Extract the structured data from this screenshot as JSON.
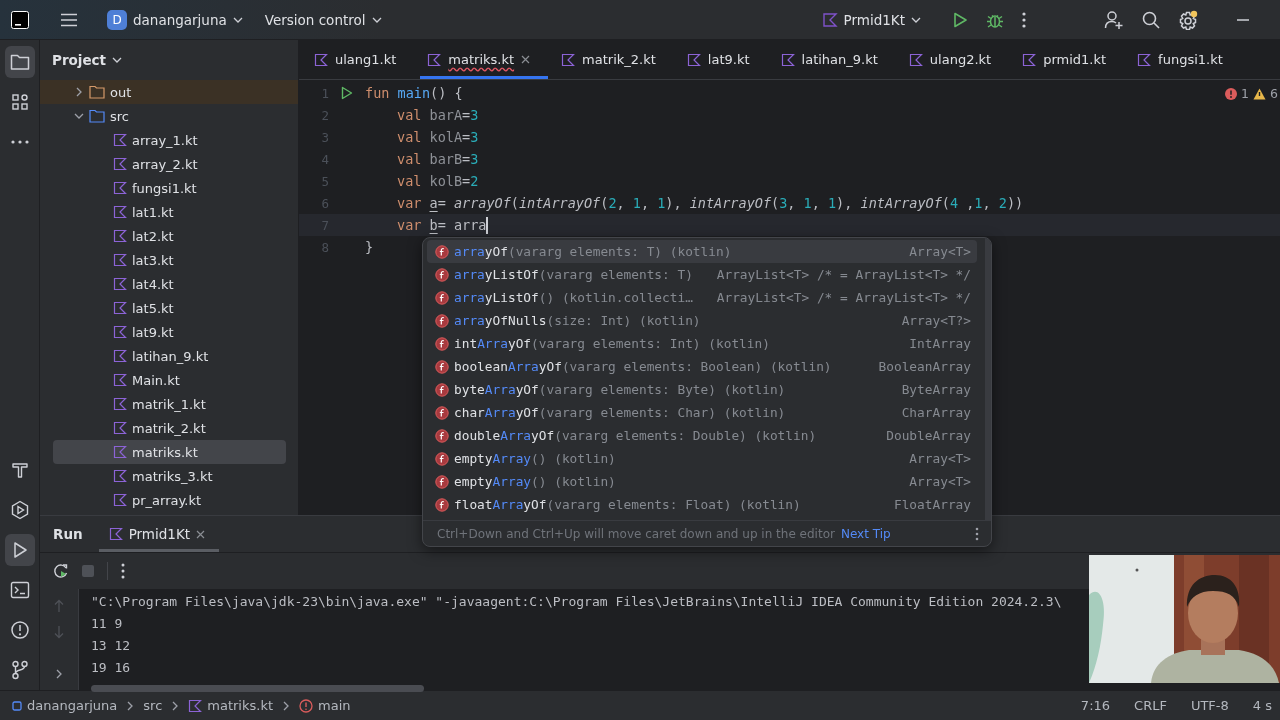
{
  "top_bar": {
    "project_initial": "D",
    "project_name": "danangarjuna",
    "vcs": "Version control",
    "run_config": "Prmid1Kt"
  },
  "tool_strip": {
    "top": [
      {
        "kind": "project",
        "selected": true
      },
      {
        "kind": "structure",
        "selected": false
      },
      {
        "kind": "more",
        "selected": false
      }
    ],
    "bottom": [
      {
        "kind": "build",
        "selected": false
      },
      {
        "kind": "services",
        "selected": false
      },
      {
        "kind": "run",
        "selected": true
      },
      {
        "kind": "terminal",
        "selected": false
      },
      {
        "kind": "problems",
        "selected": false
      },
      {
        "kind": "git",
        "selected": false
      }
    ]
  },
  "project_panel": {
    "title": "Project",
    "tree": [
      {
        "label": "out",
        "kind": "folder",
        "expanded": false,
        "excluded": true,
        "selected": false
      },
      {
        "label": "src",
        "kind": "folder",
        "expanded": true,
        "excluded": false,
        "selected": false,
        "children": [
          {
            "label": "array_1.kt",
            "selected": false
          },
          {
            "label": "array_2.kt",
            "selected": false
          },
          {
            "label": "fungsi1.kt",
            "selected": false
          },
          {
            "label": "lat1.kt",
            "selected": false
          },
          {
            "label": "lat2.kt",
            "selected": false
          },
          {
            "label": "lat3.kt",
            "selected": false
          },
          {
            "label": "lat4.kt",
            "selected": false
          },
          {
            "label": "lat5.kt",
            "selected": false
          },
          {
            "label": "lat9.kt",
            "selected": false
          },
          {
            "label": "latihan_9.kt",
            "selected": false
          },
          {
            "label": "Main.kt",
            "selected": false
          },
          {
            "label": "matrik_1.kt",
            "selected": false
          },
          {
            "label": "matrik_2.kt",
            "selected": false
          },
          {
            "label": "matriks.kt",
            "selected": true
          },
          {
            "label": "matriks_3.kt",
            "selected": false
          },
          {
            "label": "pr_array.kt",
            "selected": false
          }
        ]
      }
    ]
  },
  "editor_tabs": [
    {
      "label": "ulang1.kt",
      "selected": false,
      "error": false
    },
    {
      "label": "matriks.kt",
      "selected": true,
      "error": true
    },
    {
      "label": "matrik_2.kt",
      "selected": false,
      "error": false
    },
    {
      "label": "lat9.kt",
      "selected": false,
      "error": false
    },
    {
      "label": "latihan_9.kt",
      "selected": false,
      "error": false
    },
    {
      "label": "ulang2.kt",
      "selected": false,
      "error": false
    },
    {
      "label": "prmid1.kt",
      "selected": false,
      "error": false
    },
    {
      "label": "fungsi1.kt",
      "selected": false,
      "error": false
    }
  ],
  "inspections": {
    "errors": "1",
    "warnings": "6"
  },
  "code": [
    {
      "number": "1",
      "run": true,
      "current": false,
      "indented": false,
      "tokens": [
        {
          "kind": "kw",
          "text": "fun "
        },
        {
          "kind": "decl",
          "text": "main"
        },
        {
          "kind": "plain",
          "text": "() {"
        }
      ]
    },
    {
      "number": "2",
      "run": false,
      "current": false,
      "indented": true,
      "tokens": [
        {
          "kind": "kw",
          "text": "val "
        },
        {
          "kind": "unused",
          "text": "barA"
        },
        {
          "kind": "plain",
          "text": "="
        },
        {
          "kind": "num",
          "text": "3"
        }
      ]
    },
    {
      "number": "3",
      "run": false,
      "current": false,
      "indented": true,
      "tokens": [
        {
          "kind": "kw",
          "text": "val "
        },
        {
          "kind": "unused",
          "text": "kolA"
        },
        {
          "kind": "plain",
          "text": "="
        },
        {
          "kind": "num",
          "text": "3"
        }
      ]
    },
    {
      "number": "4",
      "run": false,
      "current": false,
      "indented": true,
      "tokens": [
        {
          "kind": "kw",
          "text": "val "
        },
        {
          "kind": "unused",
          "text": "barB"
        },
        {
          "kind": "plain",
          "text": "="
        },
        {
          "kind": "num",
          "text": "3"
        }
      ]
    },
    {
      "number": "5",
      "run": false,
      "current": false,
      "indented": true,
      "tokens": [
        {
          "kind": "kw",
          "text": "val "
        },
        {
          "kind": "unused",
          "text": "kolB"
        },
        {
          "kind": "plain",
          "text": "="
        },
        {
          "kind": "num",
          "text": "2"
        }
      ]
    },
    {
      "number": "6",
      "run": false,
      "current": false,
      "indented": true,
      "tokens": [
        {
          "kind": "kw",
          "text": "var "
        },
        {
          "kind": "mutable",
          "text": "a"
        },
        {
          "kind": "plain",
          "text": "= "
        },
        {
          "kind": "call",
          "text": "arrayOf"
        },
        {
          "kind": "plain",
          "text": "("
        },
        {
          "kind": "call",
          "text": "intArrayOf"
        },
        {
          "kind": "plain",
          "text": "("
        },
        {
          "kind": "num",
          "text": "2"
        },
        {
          "kind": "plain",
          "text": ", "
        },
        {
          "kind": "num",
          "text": "1"
        },
        {
          "kind": "plain",
          "text": ", "
        },
        {
          "kind": "num",
          "text": "1"
        },
        {
          "kind": "plain",
          "text": "), "
        },
        {
          "kind": "call",
          "text": "intArrayOf"
        },
        {
          "kind": "plain",
          "text": "("
        },
        {
          "kind": "num",
          "text": "3"
        },
        {
          "kind": "plain",
          "text": ", "
        },
        {
          "kind": "num",
          "text": "1"
        },
        {
          "kind": "plain",
          "text": ", "
        },
        {
          "kind": "num",
          "text": "1"
        },
        {
          "kind": "plain",
          "text": "), "
        },
        {
          "kind": "call",
          "text": "intArrayOf"
        },
        {
          "kind": "plain",
          "text": "("
        },
        {
          "kind": "num",
          "text": "4"
        },
        {
          "kind": "plain",
          "text": " ,"
        },
        {
          "kind": "num",
          "text": "1"
        },
        {
          "kind": "plain",
          "text": ", "
        },
        {
          "kind": "num",
          "text": "2"
        },
        {
          "kind": "plain",
          "text": "))"
        }
      ]
    },
    {
      "number": "7",
      "run": false,
      "current": true,
      "indented": true,
      "tokens": [
        {
          "kind": "kw",
          "text": "var "
        },
        {
          "kind": "mutable",
          "text": "b"
        },
        {
          "kind": "plain",
          "text": "= arra"
        }
      ]
    },
    {
      "number": "8",
      "run": false,
      "current": false,
      "indented": false,
      "tokens": [
        {
          "kind": "plain",
          "text": "}"
        }
      ]
    }
  ],
  "completion": {
    "items": [
      {
        "match": "arra",
        "tail": "yOf",
        "signature": "(vararg elements: T) (kotlin)",
        "type": "Array<T>",
        "selected": true
      },
      {
        "match": "arra",
        "tail": "yListOf",
        "signature": "(vararg elements: T)",
        "type": "ArrayList<T> /* = ArrayList<T> */",
        "selected": false
      },
      {
        "match": "arra",
        "tail": "yListOf",
        "signature": "() (kotlin.collecti…",
        "type": "ArrayList<T> /* = ArrayList<T> */",
        "selected": false
      },
      {
        "match": "arra",
        "tail": "yOfNulls",
        "signature": "(size: Int) (kotlin)",
        "type": "Array<T?>",
        "selected": false
      },
      {
        "lead": "int",
        "match": "Arra",
        "tail": "yOf",
        "signature": "(vararg elements: Int) (kotlin)",
        "type": "IntArray",
        "selected": false
      },
      {
        "lead": "boolean",
        "match": "Arra",
        "tail": "yOf",
        "signature": "(vararg elements: Boolean) (kotlin)",
        "type": "BooleanArray",
        "selected": false
      },
      {
        "lead": "byte",
        "match": "Arra",
        "tail": "yOf",
        "signature": "(vararg elements: Byte) (kotlin)",
        "type": "ByteArray",
        "selected": false
      },
      {
        "lead": "char",
        "match": "Arra",
        "tail": "yOf",
        "signature": "(vararg elements: Char) (kotlin)",
        "type": "CharArray",
        "selected": false
      },
      {
        "lead": "double",
        "match": "Arra",
        "tail": "yOf",
        "signature": "(vararg elements: Double) (kotlin)",
        "type": "DoubleArray",
        "selected": false
      },
      {
        "lead": "empty",
        "match": "Array",
        "signature": "() (kotlin)",
        "type": "Array<T>",
        "selected": false
      },
      {
        "lead": "empty",
        "match": "Array",
        "signature": "() (kotlin)",
        "type": "Array<T>",
        "selected": false
      },
      {
        "lead": "float",
        "match": "Arra",
        "tail": "yOf",
        "signature": "(vararg elements: Float) (kotlin)",
        "type": "FloatArray",
        "selected": false
      }
    ],
    "tip": "Ctrl+Down and Ctrl+Up will move caret down and up in the editor",
    "tip_link": "Next Tip"
  },
  "run_panel": {
    "title": "Run",
    "tabs": [
      {
        "label": "Prmid1Kt",
        "selected": true
      }
    ],
    "stop_disabled": true,
    "console": [
      "\"C:\\Program Files\\java\\jdk-23\\bin\\java.exe\" \"-javaagent:C:\\Program Files\\JetBrains\\IntelliJ IDEA Community Edition 2024.2.3\\",
      "11 9",
      "13 12",
      "19 16"
    ]
  },
  "status_bar": {
    "breadcrumbs": [
      {
        "kind": "module",
        "label": "danangarjuna"
      },
      {
        "kind": "folder",
        "label": "src"
      },
      {
        "kind": "kotlin",
        "label": "matriks.kt"
      },
      {
        "kind": "function",
        "label": "main"
      }
    ],
    "right": [
      "7:16",
      "CRLF",
      "UTF-8",
      "4 s"
    ]
  }
}
